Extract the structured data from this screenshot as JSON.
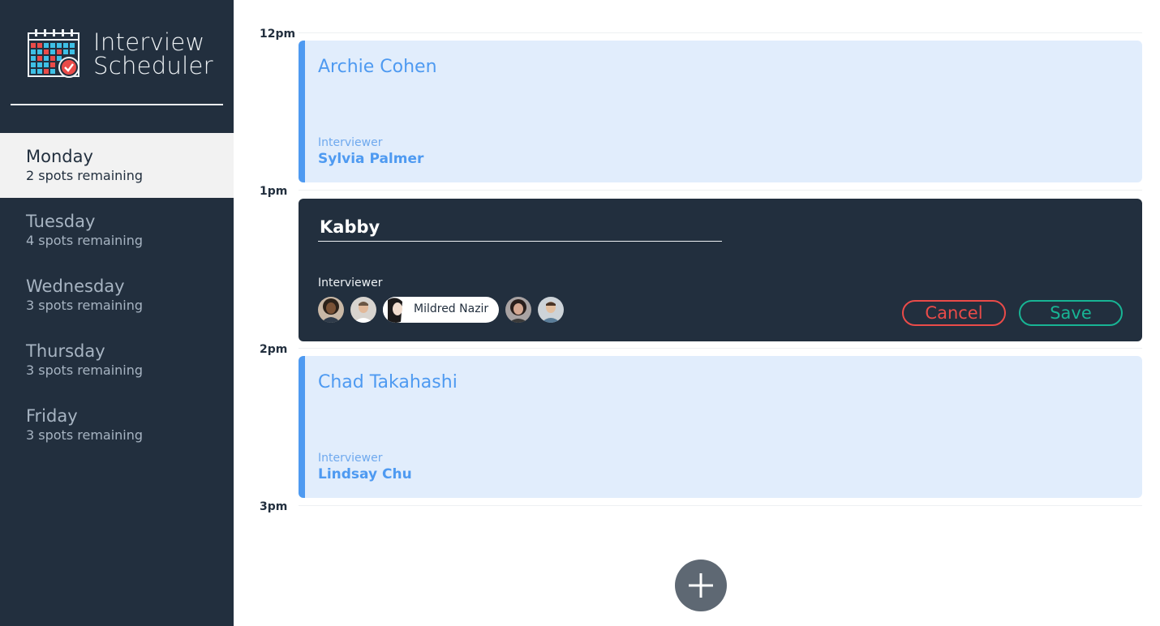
{
  "app": {
    "title_line1": "Interview",
    "title_line2": "Scheduler"
  },
  "days": [
    {
      "name": "Monday",
      "spots": "2 spots remaining",
      "selected": true
    },
    {
      "name": "Tuesday",
      "spots": "4 spots remaining",
      "selected": false
    },
    {
      "name": "Wednesday",
      "spots": "3 spots remaining",
      "selected": false
    },
    {
      "name": "Thursday",
      "spots": "3 spots remaining",
      "selected": false
    },
    {
      "name": "Friday",
      "spots": "3 spots remaining",
      "selected": false
    }
  ],
  "times": [
    "12pm",
    "1pm",
    "2pm",
    "3pm"
  ],
  "appointments": [
    {
      "student": "Archie Cohen",
      "interviewer_label": "Interviewer",
      "interviewer": "Sylvia Palmer"
    },
    {
      "student": "Chad Takahashi",
      "interviewer_label": "Interviewer",
      "interviewer": "Lindsay Chu"
    }
  ],
  "form": {
    "student_value": "Kabby",
    "interviewer_label": "Interviewer",
    "selected_interviewer": "Mildred Nazir",
    "cancel_label": "Cancel",
    "save_label": "Save"
  },
  "colors": {
    "sidebar_bg": "#222f3e",
    "appointment_bg": "#e1edfc",
    "appointment_accent": "#4e9af1",
    "cancel": "#ea4b49",
    "save": "#18b494",
    "add_button": "#5e6873"
  },
  "icons": {
    "logo": "calendar-check-icon",
    "add": "plus-icon"
  }
}
